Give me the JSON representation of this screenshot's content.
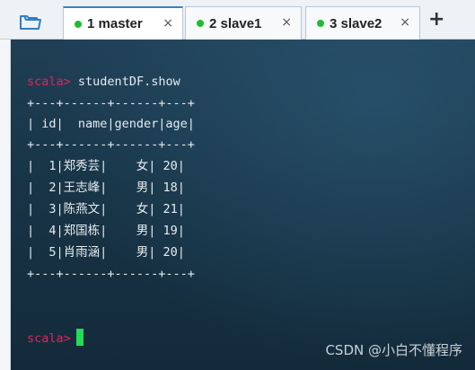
{
  "tabs": [
    {
      "label": "1 master",
      "active": true,
      "status_color": "#22bb33"
    },
    {
      "label": "2 slave1",
      "active": false,
      "status_color": "#22bb33"
    },
    {
      "label": "3 slave2",
      "active": false,
      "status_color": "#22bb33"
    }
  ],
  "tab_close_glyph": "×",
  "add_tab_glyph": "+",
  "terminal": {
    "prompt": "scala>",
    "command": "studentDF.show",
    "table_lines": [
      "+---+------+------+---+",
      "| id|  name|gender|age|",
      "+---+------+------+---+",
      "|  1|郑秀芸|    女| 20|",
      "|  2|王志峰|    男| 18|",
      "|  3|陈燕文|    女| 21|",
      "|  4|郑国栋|    男| 19|",
      "|  5|肖雨涵|    男| 20|",
      "+---+------+------+---+"
    ],
    "cursor_color": "#22dd55"
  },
  "watermark": "CSDN @小白不懂程序"
}
